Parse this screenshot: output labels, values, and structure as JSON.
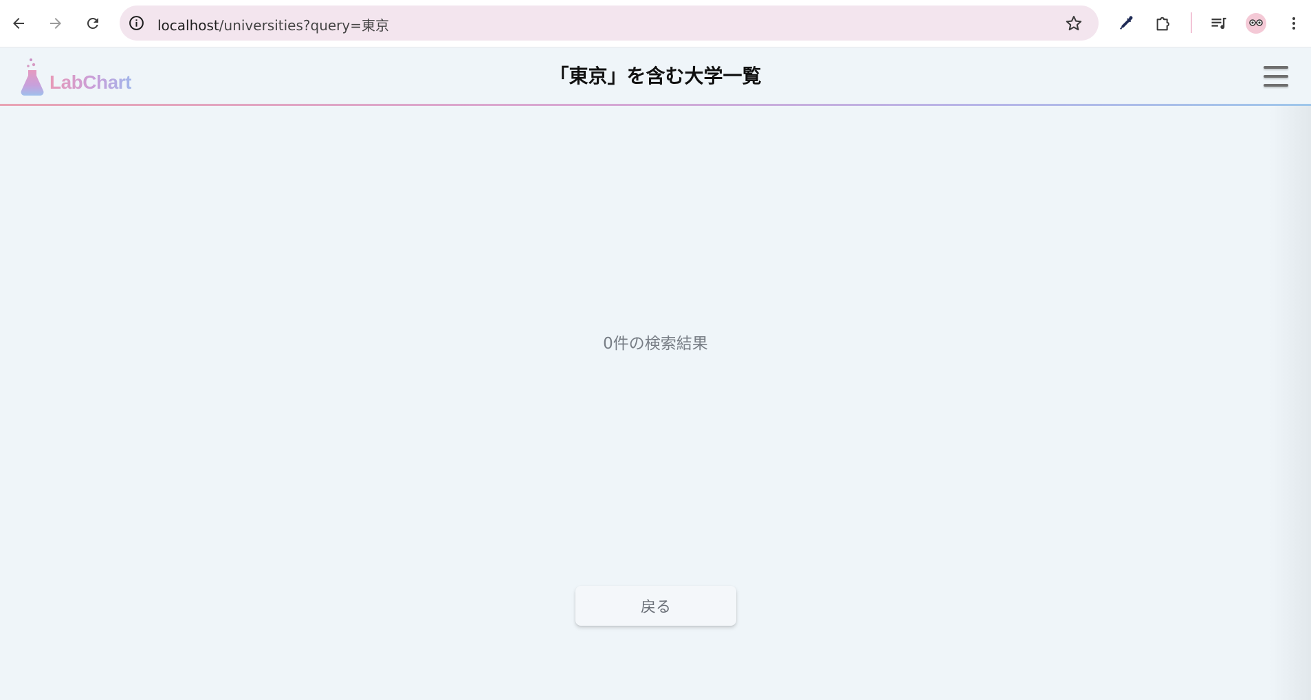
{
  "browser": {
    "url_host": "localhost",
    "url_path": "/universities?query=東京",
    "icons": {
      "back": "arrow-left-icon",
      "forward": "arrow-right-icon",
      "reload": "reload-icon",
      "site_info": "info-icon",
      "bookmark": "star-icon",
      "eyedropper": "eyedropper-icon",
      "extensions": "puzzle-icon",
      "media": "playlist-icon",
      "profile": "profile-avatar-icon",
      "menu": "more-vertical-icon"
    }
  },
  "header": {
    "logo_text": "LabChart",
    "title": "「東京」を含む大学一覧",
    "menu_icon": "hamburger-menu-icon"
  },
  "main": {
    "result_count": "0件の検索結果",
    "back_label": "戻る"
  },
  "colors": {
    "page_background": "#eff5f9",
    "omnibox_background": "#f3e5ee",
    "accent_pink": "#e79ab8",
    "accent_blue": "#a2b6ea",
    "muted_text": "#777d85"
  }
}
